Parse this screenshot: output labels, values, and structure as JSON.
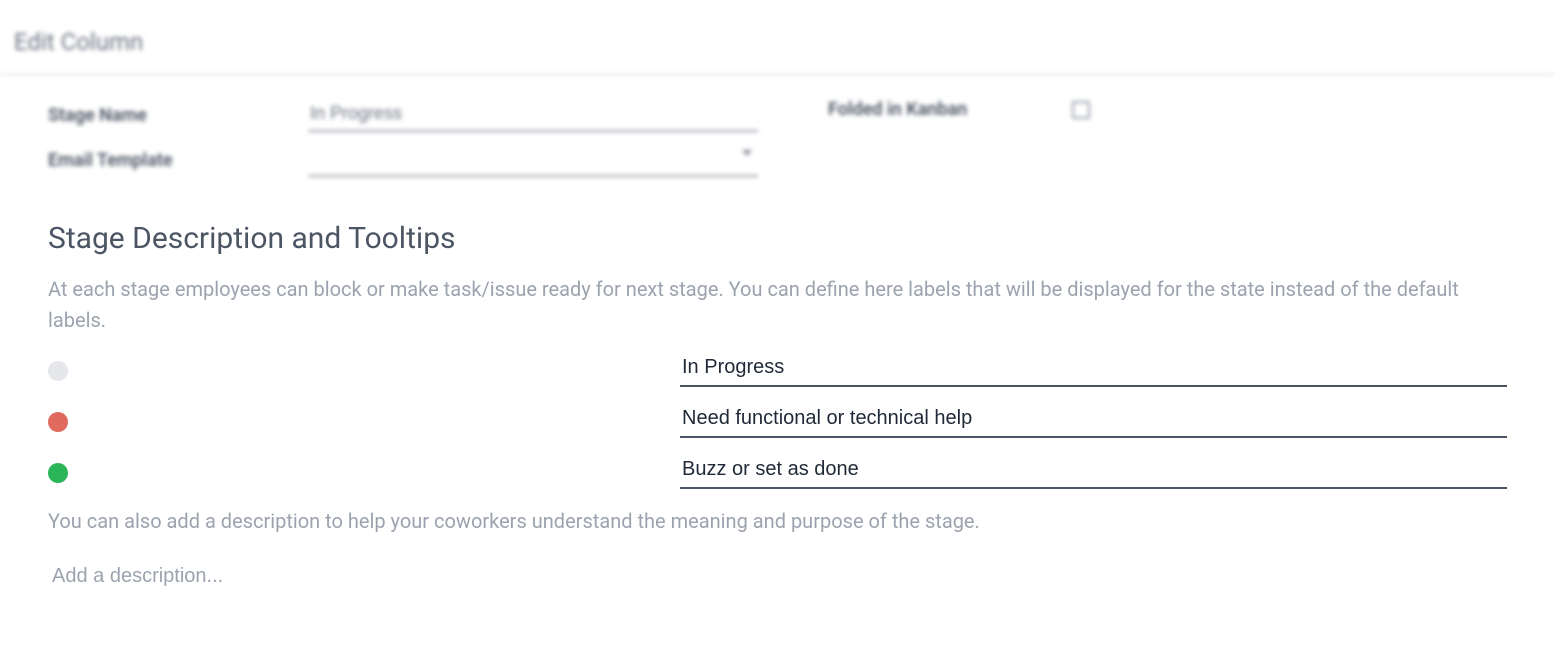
{
  "dialog": {
    "title": "Edit Column"
  },
  "form": {
    "stage_name_label": "Stage Name",
    "stage_name_value": "In Progress",
    "email_template_label": "Email Template",
    "email_template_value": "",
    "folded_label": "Folded in Kanban",
    "folded_checked": false
  },
  "section": {
    "title": "Stage Description and Tooltips",
    "helper1": "At each stage employees can block or make task/issue ready for next stage. You can define here labels that will be displayed for the state instead of the default labels.",
    "helper2": "You can also add a description to help your coworkers understand the meaning and purpose of the stage.",
    "description_placeholder": "Add a description...",
    "description_value": ""
  },
  "states": [
    {
      "color": "grey",
      "label": "In Progress"
    },
    {
      "color": "red",
      "label": "Need functional or technical help"
    },
    {
      "color": "green",
      "label": "Buzz or set as done"
    }
  ]
}
